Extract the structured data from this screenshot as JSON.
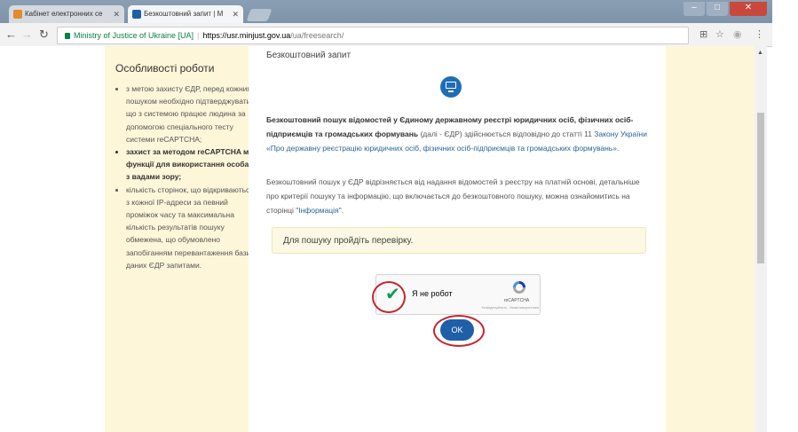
{
  "browser": {
    "tabs": [
      {
        "label": "Кабінет електронних се",
        "active": false
      },
      {
        "label": "Безкоштовний запит | М",
        "active": true
      }
    ],
    "address": {
      "security_label": "Ministry of Justice of Ukraine [UA]",
      "host": "https://usr.minjust.gov.ua",
      "path": "/ua/freesearch/"
    },
    "icons": [
      "back-arrow-icon",
      "forward-arrow-icon",
      "reload-icon",
      "lock-icon",
      "translate-icon",
      "star-icon",
      "extension-icon",
      "menu-icon"
    ]
  },
  "sidebar": {
    "title": "Особливості роботи",
    "items": [
      "з метою захисту ЄДР, перед кожним пошуком необхідно підтверджувати, що з системою працює людина за допомогою спеціального тесту системи reCAPTCHA;",
      "захист за методом reCAPTCHA має функції для використання особами з вадами зору;",
      "кількість сторінок, що відкриваються з кожної IP-адреси за певний проміжок часу та максимальна кількість результатів пошуку обмежена, що обумовлено запобіганням перевантаження бази даних ЄДР запитами."
    ]
  },
  "main": {
    "title": "Безкоштовний запит",
    "p1_bold": "Безкоштовний пошук відомостей у Єдиному державному реєстрі юридичних осіб, фізичних осіб-підприємців та громадських формувань",
    "p1_mid": " (далі - ЄДР) здійснюється відповідно до статті 11 ",
    "p1_link": "Закону України «Про державну реєстрацію юридичних осіб, фізичних осіб-підприємців та громадських формувань».",
    "p2_text": "Безкоштовний пошук у ЄДР відрізняється від надання відомостей з реєстру на платній основі, детальніше про критерії пошуку та інформацію, що включається до безкоштовного пошуку, можна ознайомитись на сторінці ",
    "p2_link": "\"Інформація\"",
    "p2_end": ".",
    "notice": "Для пошуку пройдіть перевірку.",
    "recaptcha": {
      "label": "Я не робот",
      "brand": "reCAPTCHA",
      "terms": "Конфіденційність - Умови використання",
      "checked": true
    },
    "ok_label": "OK"
  },
  "colors": {
    "sidebar_bg": "#fdf6d8",
    "button": "#1f5fa8",
    "annotation": "#c8232c",
    "link": "#2a6496"
  }
}
